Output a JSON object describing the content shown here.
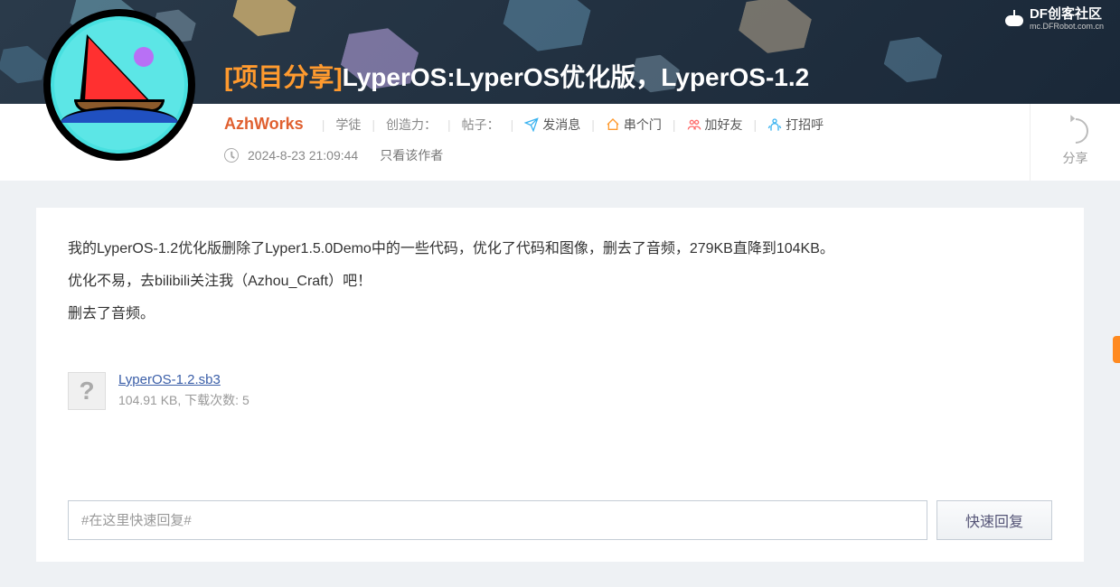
{
  "brand": {
    "name": "DF创客社区",
    "url": "mc.DFRobot.com.cn"
  },
  "post": {
    "category": "[项目分享]",
    "title": "LyperOS:LyperOS优化版，LyperOS-1.2",
    "author": "AzhWorks",
    "rank": "学徒",
    "stats": {
      "creativity_label": "创造力：",
      "posts_label": "帖子："
    },
    "timestamp": "2024-8-23 21:09:44",
    "only_author": "只看该作者"
  },
  "actions": {
    "msg": "发消息",
    "visit": "串个门",
    "friend": "加好友",
    "greet": "打招呼",
    "share": "分享"
  },
  "body": {
    "paragraphs": [
      "我的LyperOS-1.2优化版删除了Lyper1.5.0Demo中的一些代码，优化了代码和图像，删去了音频，279KB直降到104KB。",
      "优化不易，去bilibili关注我（Azhou_Craft）吧！",
      "",
      "删去了音频。"
    ]
  },
  "attachment": {
    "name": "LyperOS-1.2.sb3",
    "size": "104.91 KB",
    "download_label": "下载次数",
    "download_count": "5"
  },
  "reply": {
    "placeholder": "#在这里快速回复#",
    "button": "快速回复"
  }
}
